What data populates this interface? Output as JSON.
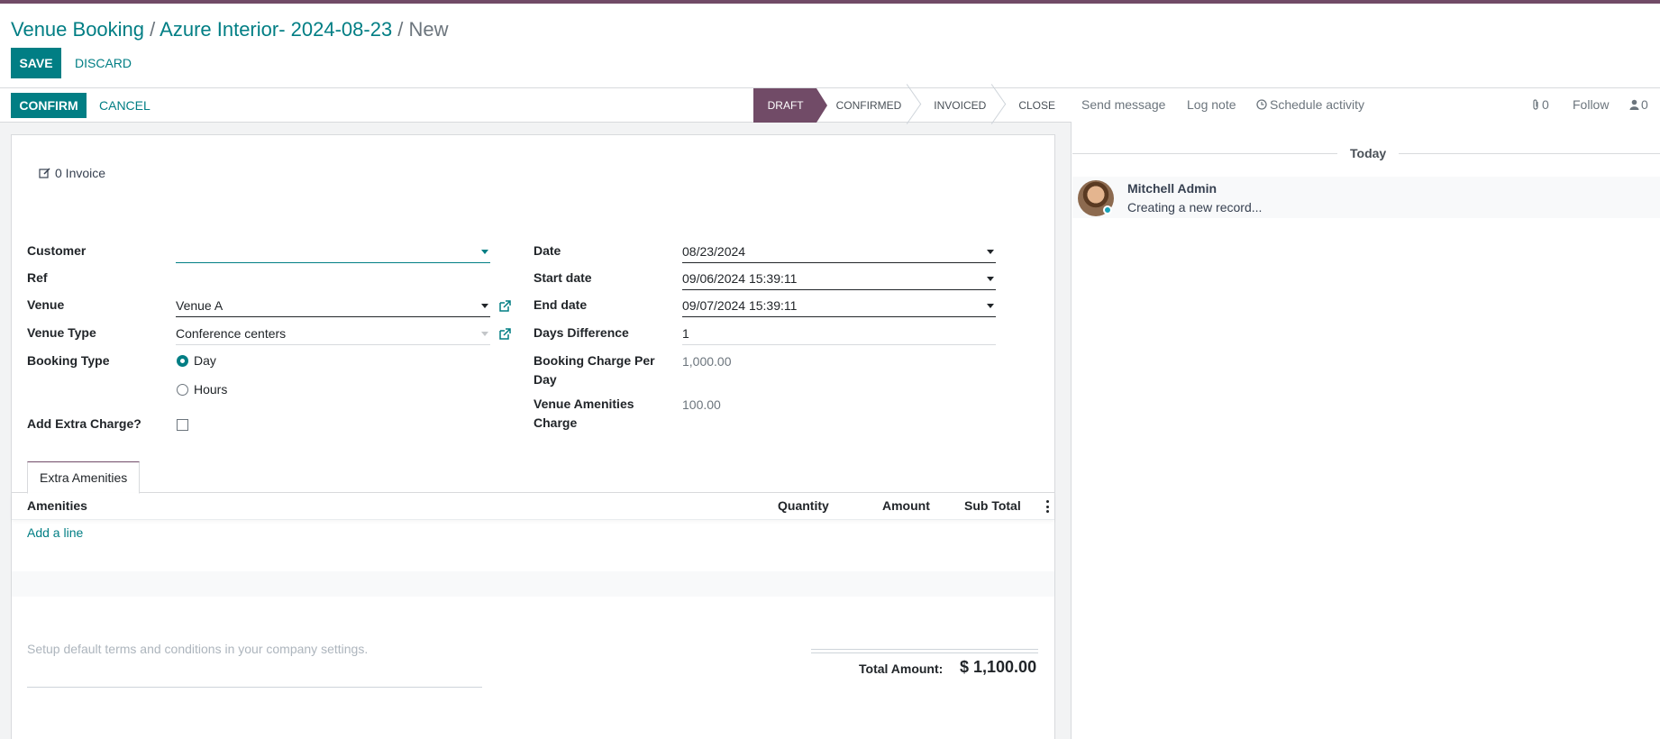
{
  "breadcrumb": {
    "root": "Venue Booking",
    "parent": "Azure Interior- 2024-08-23",
    "current": "New",
    "sep": " / "
  },
  "actions": {
    "save": "SAVE",
    "discard": "DISCARD"
  },
  "statusbar": {
    "confirm": "CONFIRM",
    "cancel": "CANCEL",
    "stages": [
      "DRAFT",
      "CONFIRMED",
      "INVOICED",
      "CLOSE"
    ],
    "active_stage": "DRAFT"
  },
  "smart": {
    "invoice": "0 Invoice"
  },
  "form": {
    "customer_label": "Customer",
    "customer_value": "",
    "ref_label": "Ref",
    "ref_value": "",
    "venue_label": "Venue",
    "venue_value": "Venue A",
    "venue_type_label": "Venue Type",
    "venue_type_value": "Conference centers",
    "booking_type_label": "Booking Type",
    "booking_day": "Day",
    "booking_hours": "Hours",
    "extra_charge_label": "Add Extra Charge?",
    "date_label": "Date",
    "date_value": "08/23/2024",
    "start_label": "Start date",
    "start_value": "09/06/2024 15:39:11",
    "end_label": "End date",
    "end_value": "09/07/2024 15:39:11",
    "diff_label": "Days Difference",
    "diff_value": "1",
    "charge_label_1": "Booking Charge Per",
    "charge_label_2": "Day",
    "charge_value": "1,000.00",
    "amen_label_1": "Venue Amenities",
    "amen_label_2": "Charge",
    "amen_value": "100.00"
  },
  "tabs": {
    "extra": "Extra Amenities"
  },
  "lines": {
    "col_amenities": "Amenities",
    "col_quantity": "Quantity",
    "col_amount": "Amount",
    "col_subtotal": "Sub Total",
    "add_line": "Add a line"
  },
  "footer": {
    "terms": "Setup default terms and conditions in your company settings.",
    "total_label": "Total Amount:",
    "total_value": "$ 1,100.00"
  },
  "chatter": {
    "send": "Send message",
    "log": "Log note",
    "schedule": "Schedule activity",
    "attachments": "0",
    "follow": "Follow",
    "followers": "0",
    "today": "Today",
    "author": "Mitchell Admin",
    "message": "Creating a new record..."
  },
  "colors": {
    "brand": "#714B67",
    "accent": "#017e84"
  }
}
